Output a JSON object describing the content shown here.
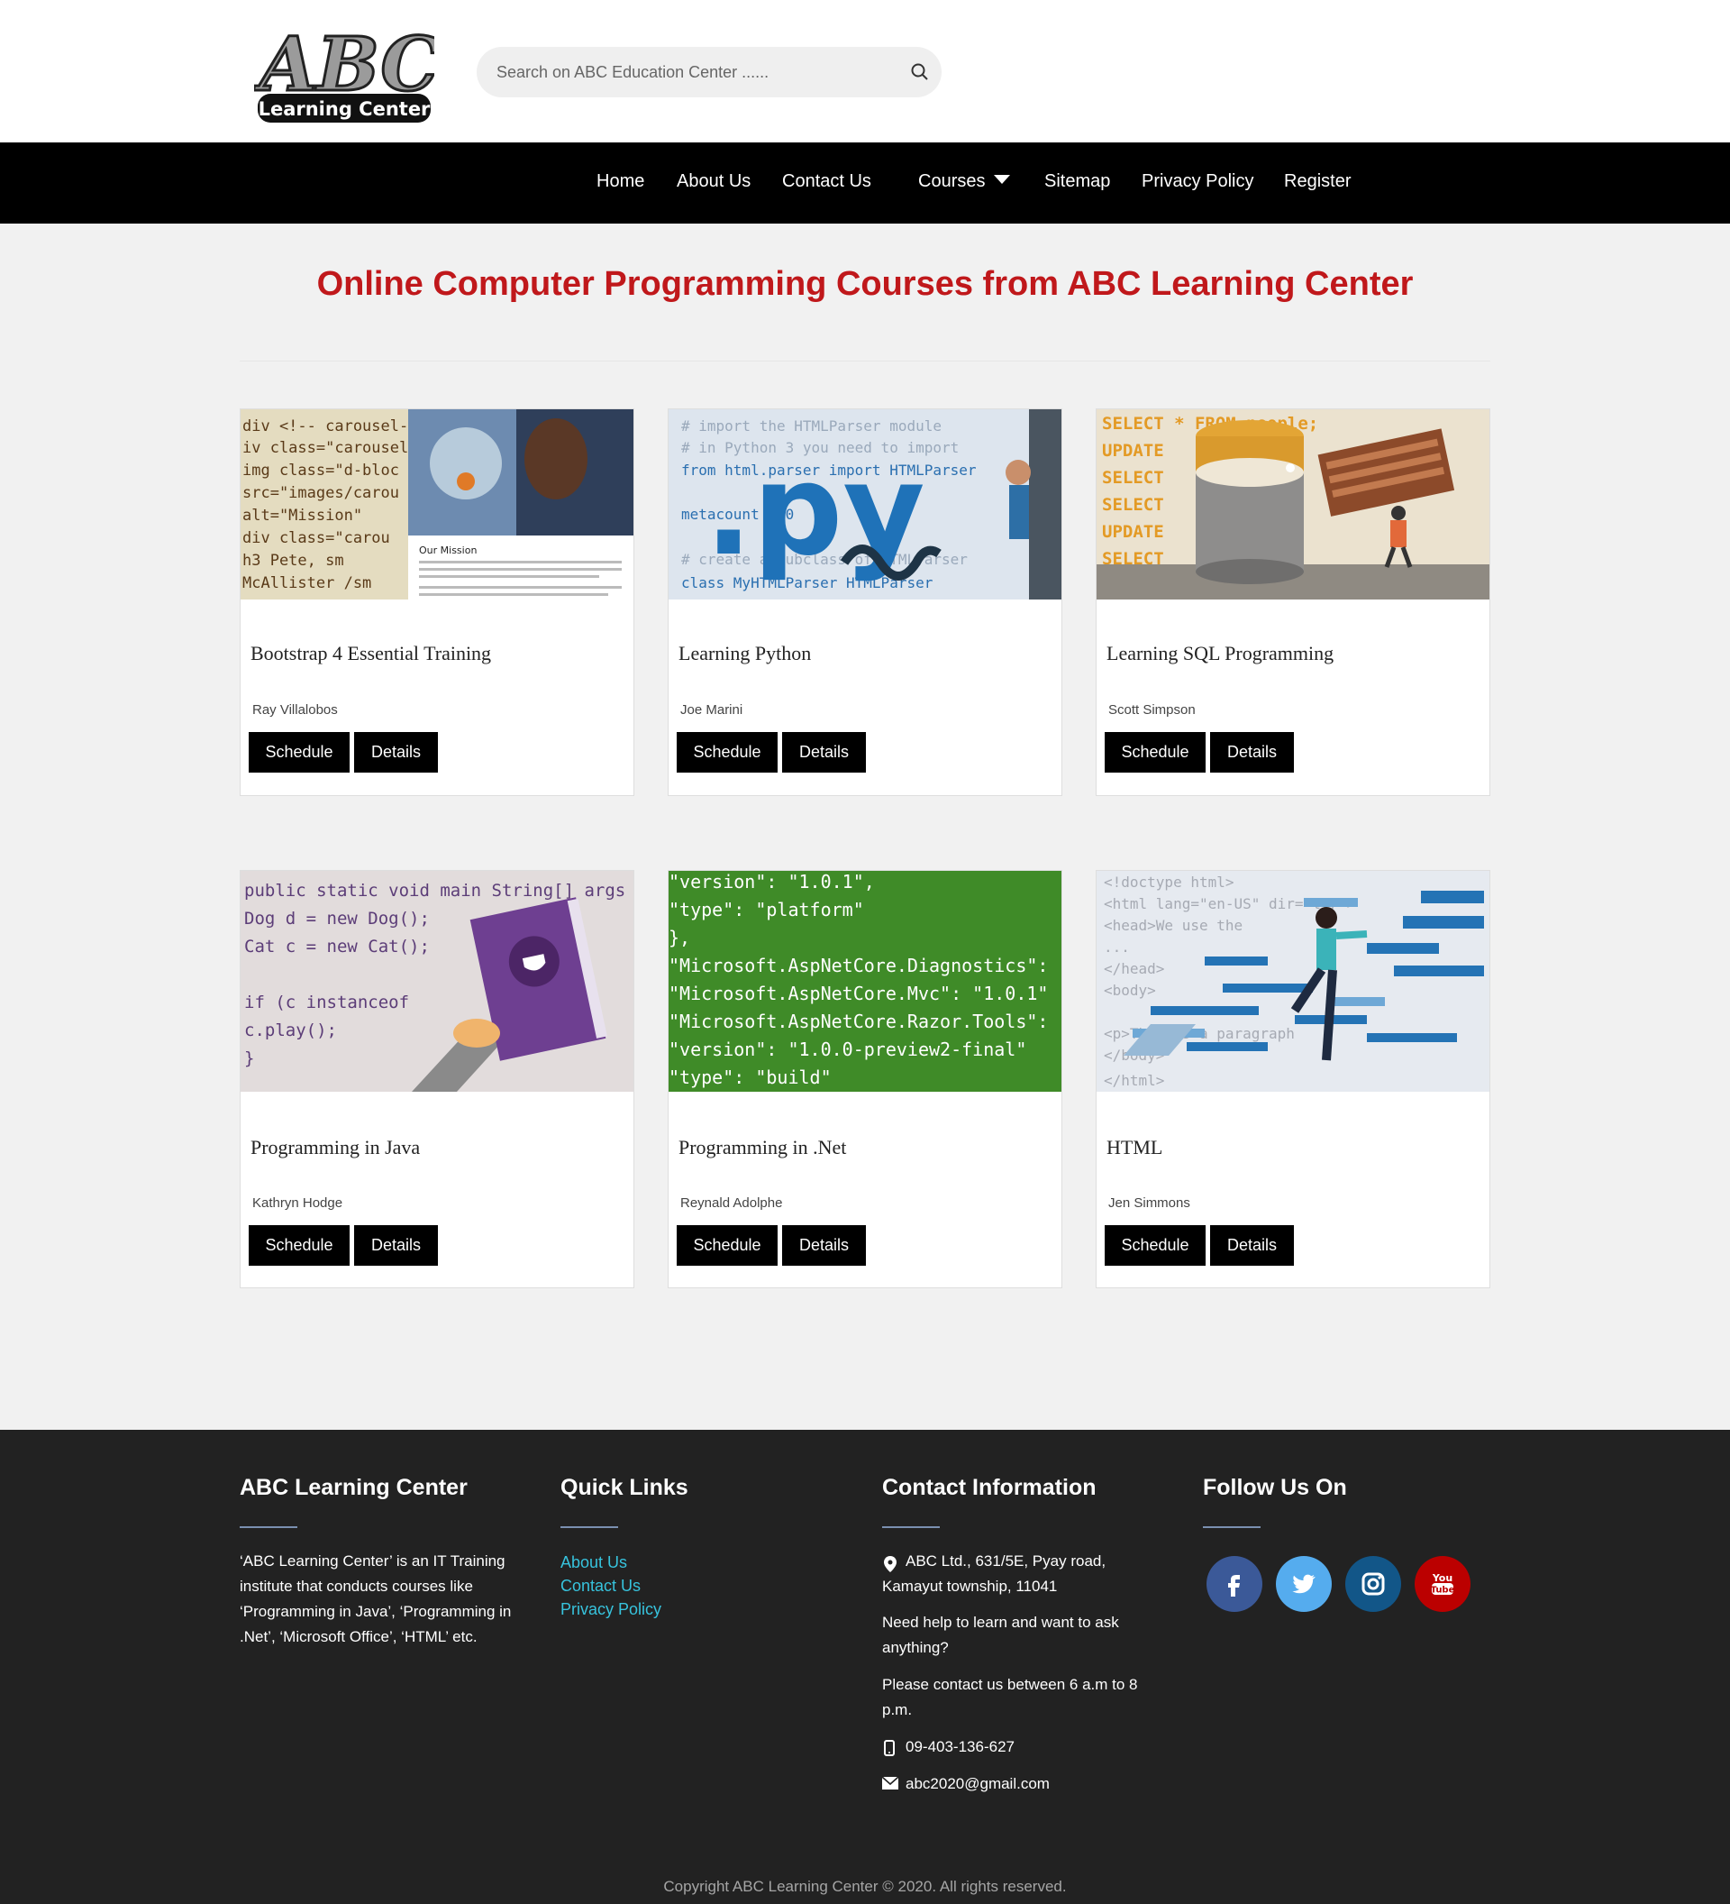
{
  "header": {
    "logo": {
      "brand_letters": "ABC",
      "tagline": "Learning Center"
    },
    "search": {
      "placeholder": "Search on ABC Education Center ......"
    }
  },
  "nav": {
    "items": [
      {
        "label": "Home"
      },
      {
        "label": "About Us"
      },
      {
        "label": "Contact Us"
      },
      {
        "label": "Courses"
      },
      {
        "label": "Sitemap"
      },
      {
        "label": "Privacy Policy"
      },
      {
        "label": "Register"
      }
    ]
  },
  "main": {
    "title": "Online Computer Programming Courses from ABC Learning Center",
    "courses": [
      {
        "title": "Bootstrap 4 Essential Training",
        "author": "Ray Villalobos",
        "schedule_label": "Schedule",
        "details_label": "Details",
        "image": {
          "code_lines": [
            "div <!-- carousel-",
            "iv class=\"carousel",
            " img class=\"d-bloc",
            "  src=\"images/carou",
            "  alt=\"Mission\"",
            " div class=\"carou",
            "  h3  Pete, sm",
            "  McAllister /sm"
          ],
          "caption": "Our Mission"
        }
      },
      {
        "title": "Learning Python",
        "author": "Joe Marini",
        "schedule_label": "Schedule",
        "details_label": "Details",
        "image": {
          "big_text": ".py",
          "code_lines": [
            "# import the HTMLParser module",
            "# in Python 3 you need to import",
            "from html.parser import HTMLParser",
            "metacount = 0",
            "# create a subclass of HTMLParser",
            "class MyHTMLParser HTMLParser"
          ]
        }
      },
      {
        "title": "Learning SQL Programming",
        "author": "Scott Simpson",
        "schedule_label": "Schedule",
        "details_label": "Details",
        "image": {
          "code_lines": [
            "SELECT  *  FROM people;",
            "UPDATE",
            "SELECT",
            "SELECT",
            "UPDATE",
            "SELECT"
          ]
        }
      },
      {
        "title": "Programming in Java",
        "author": "Kathryn Hodge",
        "schedule_label": "Schedule",
        "details_label": "Details",
        "image": {
          "code_lines": [
            "public static void main String[] args",
            "   Dog d = new Dog();",
            "   Cat c = new Cat();",
            "",
            "   if (c instanceof",
            "      c.play();",
            "   }"
          ]
        }
      },
      {
        "title": "Programming in .Net",
        "author": "Reynald Adolphe",
        "schedule_label": "Schedule",
        "details_label": "Details",
        "image": {
          "code_lines": [
            "  \"version\": \"1.0.1\",",
            "  \"type\": \"platform\"",
            "},",
            "\"Microsoft.AspNetCore.Diagnostics\":",
            "\"Microsoft.AspNetCore.Mvc\": \"1.0.1\"",
            "\"Microsoft.AspNetCore.Razor.Tools\":",
            "  \"version\": \"1.0.0-preview2-final\"",
            "  \"type\": \"build\""
          ]
        }
      },
      {
        "title": "HTML",
        "author": "Jen Simmons",
        "schedule_label": "Schedule",
        "details_label": "Details",
        "image": {
          "code_lines": [
            "<!doctype html>",
            "<html lang=\"en-US\" dir=\"ltr\">",
            "   <head>We use the",
            "   ...",
            "   </head>",
            "   <body>",
            "",
            "   <p>This is a paragraph",
            "   </body>",
            "</html>"
          ]
        }
      }
    ]
  },
  "footer": {
    "about": {
      "heading": "ABC Learning Center",
      "text_lines": [
        "‘ABC Learning Center’ is an IT Training",
        "institute that conducts courses like",
        "‘Programming in Java’, ‘Programming in",
        ".Net’, ‘Microsoft Office’, ‘HTML’ etc."
      ]
    },
    "quick_links": {
      "heading": "Quick Links",
      "links": [
        "About Us",
        "Contact Us",
        "Privacy Policy"
      ]
    },
    "contact": {
      "heading": "Contact Information",
      "address_line1": "ABC Ltd., 631/5E, Pyay road,",
      "address_line2": "Kamayut township, 11041",
      "help_line1": "Need help to learn and want to ask",
      "help_line2": "anything?",
      "hours_line1": "Please contact us between 6 a.m to 8",
      "hours_line2": "p.m.",
      "phone": "09-403-136-627",
      "email": "abc2020@gmail.com"
    },
    "follow": {
      "heading": "Follow Us On",
      "networks": [
        {
          "name": "facebook-icon",
          "color": "#3b5998"
        },
        {
          "name": "twitter-icon",
          "color": "#55acee"
        },
        {
          "name": "instagram-icon",
          "color": "#125688"
        },
        {
          "name": "youtube-icon",
          "color": "#bb0000",
          "label_top": "You",
          "label_bottom": "Tube"
        }
      ]
    },
    "copyright": "Copyright  ABC Learning Center © 2020. All rights reserved."
  },
  "colors": {
    "title_red": "#c0181b",
    "link_cyan": "#37c3dd",
    "footer_bg": "#222222",
    "nav_bg": "#000000",
    "net_green": "#3f8b28"
  }
}
